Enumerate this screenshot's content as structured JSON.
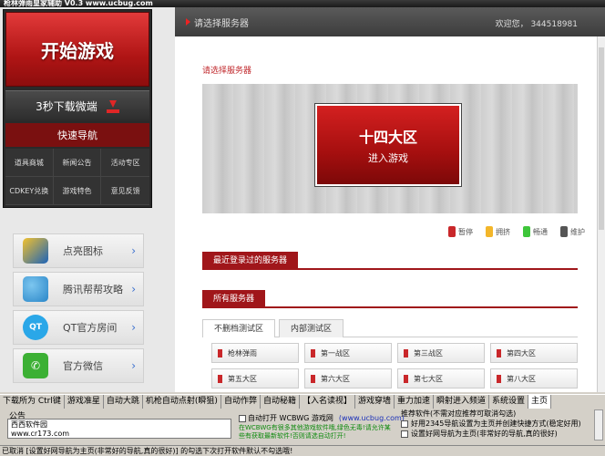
{
  "window": {
    "title": "枪林弹雨皇家辅助 V0.3   www.ucbug.com"
  },
  "left": {
    "start_label": "开始游戏",
    "download_label": "3秒下载微端",
    "quicknav_label": "快速导航",
    "grid": [
      "道具商城",
      "新闻公告",
      "活动专区",
      "CDKEY兑换",
      "游戏特色",
      "意见反馈"
    ],
    "side_items": [
      {
        "label": "点亮图标",
        "icon": "gun-icon"
      },
      {
        "label": "腾讯帮帮攻略",
        "icon": "puzzle-icon"
      },
      {
        "label": "QT官方房间",
        "icon": "qt-icon",
        "icon_text": "QT"
      },
      {
        "label": "官方微信",
        "icon": "wechat-icon"
      }
    ]
  },
  "right": {
    "header_label": "请选择服务器",
    "welcome": "欢迎您，  344518981",
    "sub_title": "请选择服务器",
    "banner": {
      "big": "十四大区",
      "small": "进入游戏"
    },
    "legend": [
      {
        "label": "暂停",
        "color": "#c9272a"
      },
      {
        "label": "拥挤",
        "color": "#f3b62a"
      },
      {
        "label": "畅通",
        "color": "#3ec63a"
      },
      {
        "label": "维护",
        "color": "#555555"
      }
    ],
    "recent_label": "最近登录过的服务器",
    "all_label": "所有服务器",
    "tabs": [
      "不删档测试区",
      "内部测试区"
    ],
    "servers": [
      "枪林弹雨",
      "第一战区",
      "第三战区",
      "第四大区",
      "第五大区",
      "第六大区",
      "第七大区",
      "第八大区"
    ]
  },
  "toolbar": {
    "tools": [
      "下载所为 Ctrl键",
      "游戏准星",
      "自动大跳",
      "机枪自动点射(瞬狙)",
      "自动作弊",
      "自动秘籍",
      "【入名读视】",
      "游戏穿墙",
      "重力加速",
      "瞬射进入频道",
      "系统设置",
      "主页"
    ],
    "active_index": 11
  },
  "bottom": {
    "notice_label": "公告",
    "notice_lines": [
      "西西软件园",
      "www.cr173.com"
    ],
    "auto_open_label": "自动打开 WCBWG 游戏网",
    "auto_open_url": "(www.ucbug.com)",
    "green_text": "在WCBWG有很多其他游戏软件哦,绿色无毒!请允许某些有获取最新软件!否则请选自动打开!",
    "recommend_title": "推荐软件(不需对应推荐可取消勾选)",
    "recommend_items": [
      "好用2345导航设置为主页并创建快捷方式(稳定好用)",
      "设置好网导航为主页(非常好的导航,真的很好)"
    ]
  },
  "status_text": "已取消 [设置好网导航为主页(非常好的导航,真的很好)] 的勾选下次打开软件默认不勾选哦!"
}
